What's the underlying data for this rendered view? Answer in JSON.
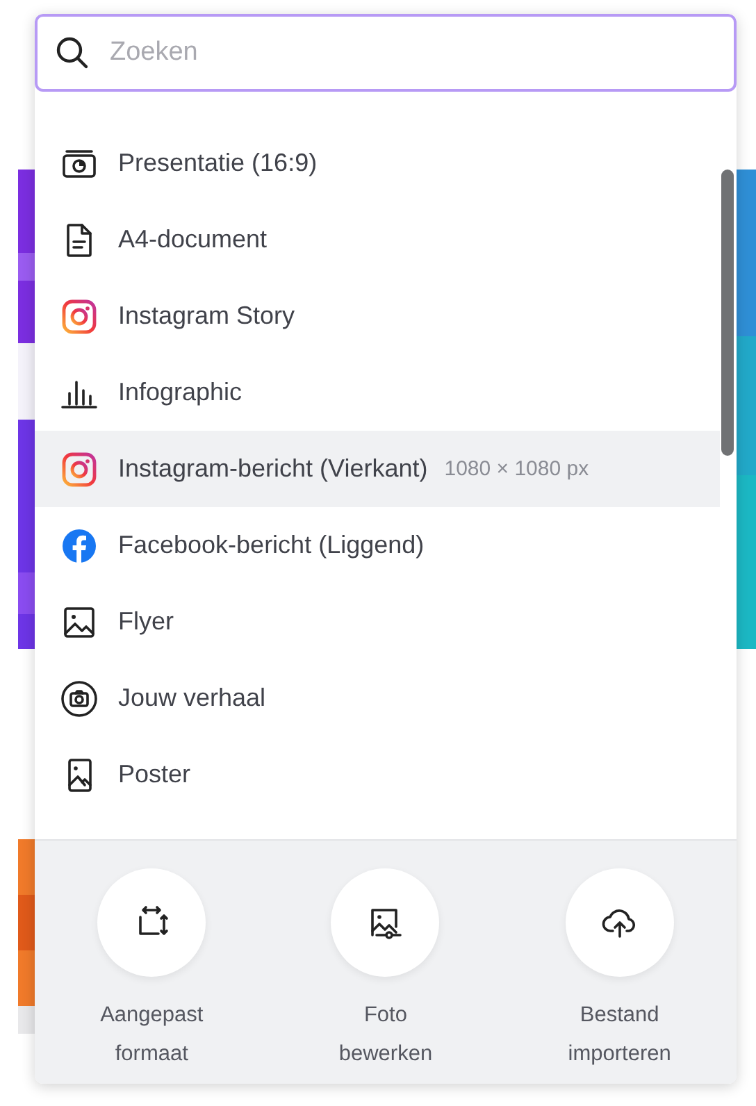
{
  "search": {
    "placeholder": "Zoeken"
  },
  "items": [
    {
      "label": "Presentatie (16:9)",
      "selected": false
    },
    {
      "label": "A4-document",
      "selected": false
    },
    {
      "label": "Instagram Story",
      "selected": false
    },
    {
      "label": "Infographic",
      "selected": false
    },
    {
      "label": "Instagram-bericht (Vierkant)",
      "size": "1080 × 1080 px",
      "selected": true
    },
    {
      "label": "Facebook-bericht (Liggend)",
      "selected": false
    },
    {
      "label": "Flyer",
      "selected": false
    },
    {
      "label": "Jouw verhaal",
      "selected": false
    },
    {
      "label": "Poster",
      "selected": false
    }
  ],
  "actions": [
    {
      "label": "Aangepast\nformaat"
    },
    {
      "label": "Foto\nbewerken"
    },
    {
      "label": "Bestand\nimporteren"
    }
  ]
}
